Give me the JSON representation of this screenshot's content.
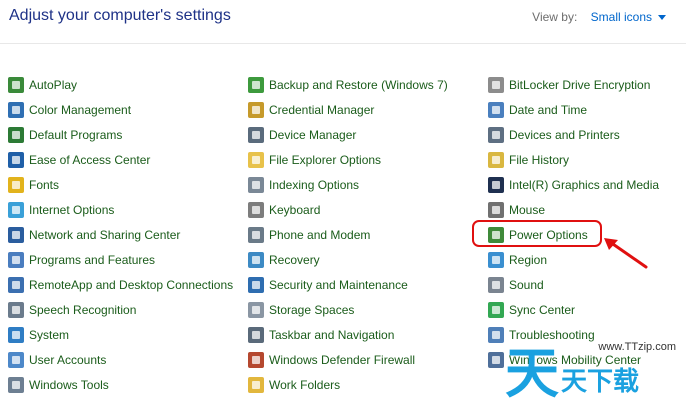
{
  "header": {
    "title": "Adjust your computer's settings",
    "view_by_label": "View by:",
    "view_by_value": "Small icons"
  },
  "columns": [
    [
      {
        "label": "AutoPlay",
        "icon": "autoplay-icon",
        "color": "#3a8a3a"
      },
      {
        "label": "Color Management",
        "icon": "color-management-icon",
        "color": "#2f6fb3"
      },
      {
        "label": "Default Programs",
        "icon": "default-programs-icon",
        "color": "#2c7a35"
      },
      {
        "label": "Ease of Access Center",
        "icon": "ease-of-access-icon",
        "color": "#1f5fa8"
      },
      {
        "label": "Fonts",
        "icon": "fonts-icon",
        "color": "#e2b31c"
      },
      {
        "label": "Internet Options",
        "icon": "internet-options-icon",
        "color": "#3aa0d8"
      },
      {
        "label": "Network and Sharing Center",
        "icon": "network-icon",
        "color": "#2a5d9e"
      },
      {
        "label": "Programs and Features",
        "icon": "programs-icon",
        "color": "#4a7dbf"
      },
      {
        "label": "RemoteApp and Desktop Connections",
        "icon": "remoteapp-icon",
        "color": "#3b6fb0"
      },
      {
        "label": "Speech Recognition",
        "icon": "microphone-icon",
        "color": "#6b7b8c"
      },
      {
        "label": "System",
        "icon": "system-icon",
        "color": "#2f7dc4"
      },
      {
        "label": "User Accounts",
        "icon": "user-accounts-icon",
        "color": "#4d88c9"
      },
      {
        "label": "Windows Tools",
        "icon": "windows-tools-icon",
        "color": "#6d7f92"
      }
    ],
    [
      {
        "label": "Backup and Restore (Windows 7)",
        "icon": "backup-icon",
        "color": "#3d9a3d"
      },
      {
        "label": "Credential Manager",
        "icon": "credential-icon",
        "color": "#c69a2b"
      },
      {
        "label": "Device Manager",
        "icon": "device-manager-icon",
        "color": "#5a6b7c"
      },
      {
        "label": "File Explorer Options",
        "icon": "folder-icon",
        "color": "#e8c24a"
      },
      {
        "label": "Indexing Options",
        "icon": "indexing-icon",
        "color": "#7a8896"
      },
      {
        "label": "Keyboard",
        "icon": "keyboard-icon",
        "color": "#7d7d7d"
      },
      {
        "label": "Phone and Modem",
        "icon": "phone-modem-icon",
        "color": "#6a7a88"
      },
      {
        "label": "Recovery",
        "icon": "recovery-icon",
        "color": "#3d8ac4"
      },
      {
        "label": "Security and Maintenance",
        "icon": "flag-icon",
        "color": "#2e6db0"
      },
      {
        "label": "Storage Spaces",
        "icon": "storage-icon",
        "color": "#8a96a3"
      },
      {
        "label": "Taskbar and Navigation",
        "icon": "taskbar-icon",
        "color": "#5a6a7a"
      },
      {
        "label": "Windows Defender Firewall",
        "icon": "firewall-icon",
        "color": "#b5482f"
      },
      {
        "label": "Work Folders",
        "icon": "work-folders-icon",
        "color": "#e2b73d"
      }
    ],
    [
      {
        "label": "BitLocker Drive Encryption",
        "icon": "bitlocker-icon",
        "color": "#8c8c8c"
      },
      {
        "label": "Date and Time",
        "icon": "clock-icon",
        "color": "#4a7fbe"
      },
      {
        "label": "Devices and Printers",
        "icon": "printer-icon",
        "color": "#5e6f82"
      },
      {
        "label": "File History",
        "icon": "file-history-icon",
        "color": "#d9b740"
      },
      {
        "label": "Intel(R) Graphics and Media",
        "icon": "intel-graphics-icon",
        "color": "#1f3050"
      },
      {
        "label": "Mouse",
        "icon": "mouse-icon",
        "color": "#707070"
      },
      {
        "label": "Power Options",
        "icon": "power-options-icon",
        "color": "#3f8a3a"
      },
      {
        "label": "Region",
        "icon": "globe-icon",
        "color": "#3a8fd0"
      },
      {
        "label": "Sound",
        "icon": "speaker-icon",
        "color": "#7a8490"
      },
      {
        "label": "Sync Center",
        "icon": "sync-icon",
        "color": "#33a853"
      },
      {
        "label": "Troubleshooting",
        "icon": "troubleshooting-icon",
        "color": "#4f7fb8"
      },
      {
        "label": "Windows Mobility Center",
        "icon": "mobility-icon",
        "color": "#4f6f9a"
      }
    ]
  ],
  "watermark": {
    "url": "www.TTzip.com",
    "big_char": "天",
    "small_chars": "天下载"
  }
}
